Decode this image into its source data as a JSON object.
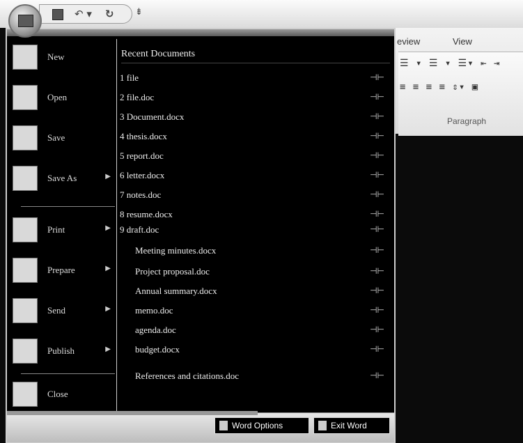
{
  "quick_access": {
    "save_icon": "save-icon",
    "undo_icon": "undo-icon",
    "undo_glyph": "↶ ▾",
    "redo_icon": "redo-icon",
    "redo_glyph": "↻",
    "customize_glyph": "⇟"
  },
  "ribbon": {
    "tabs": [
      "Review",
      "View"
    ],
    "tab_review_display": "eview",
    "row1": "☰ ▾ ☰ ▾ ☰▾ ⇤ ⇥",
    "row2": "≡ ≡ ≡ ≡ ⇕▾ ▣",
    "group_label": "Paragraph"
  },
  "menu": {
    "commands": [
      {
        "label": "New",
        "icon": "new-document-icon",
        "has_submenu": false
      },
      {
        "label": "Open",
        "icon": "open-folder-icon",
        "has_submenu": false
      },
      {
        "label": "Save",
        "icon": "save-disk-icon",
        "has_submenu": false
      },
      {
        "label": "Save As",
        "icon": "save-as-icon",
        "has_submenu": true
      },
      {
        "label": "Print",
        "icon": "printer-icon",
        "has_submenu": true
      },
      {
        "label": "Prepare",
        "icon": "prepare-icon",
        "has_submenu": true
      },
      {
        "label": "Send",
        "icon": "send-icon",
        "has_submenu": true
      },
      {
        "label": "Publish",
        "icon": "publish-icon",
        "has_submenu": true
      },
      {
        "label": "Close",
        "icon": "close-folder-icon",
        "has_submenu": false
      }
    ],
    "arrow_glyph": "▶",
    "recent_title": "Recent Documents",
    "pin_glyph": "⊣⊢",
    "recent_items": [
      "1 file",
      "2 file.doc",
      "3 Document.docx",
      "4 thesis.docx",
      "5 report.doc",
      "6 letter.docx",
      "7 notes.doc",
      "8 resume.docx",
      "9 draft.doc",
      "Meeting minutes.docx",
      "Project proposal.doc",
      "Annual summary.docx",
      "memo.doc",
      "agenda.doc",
      "budget.docx",
      "References and citations.doc"
    ],
    "word_options_label": "Word Options",
    "exit_word_label": "Exit Word"
  }
}
